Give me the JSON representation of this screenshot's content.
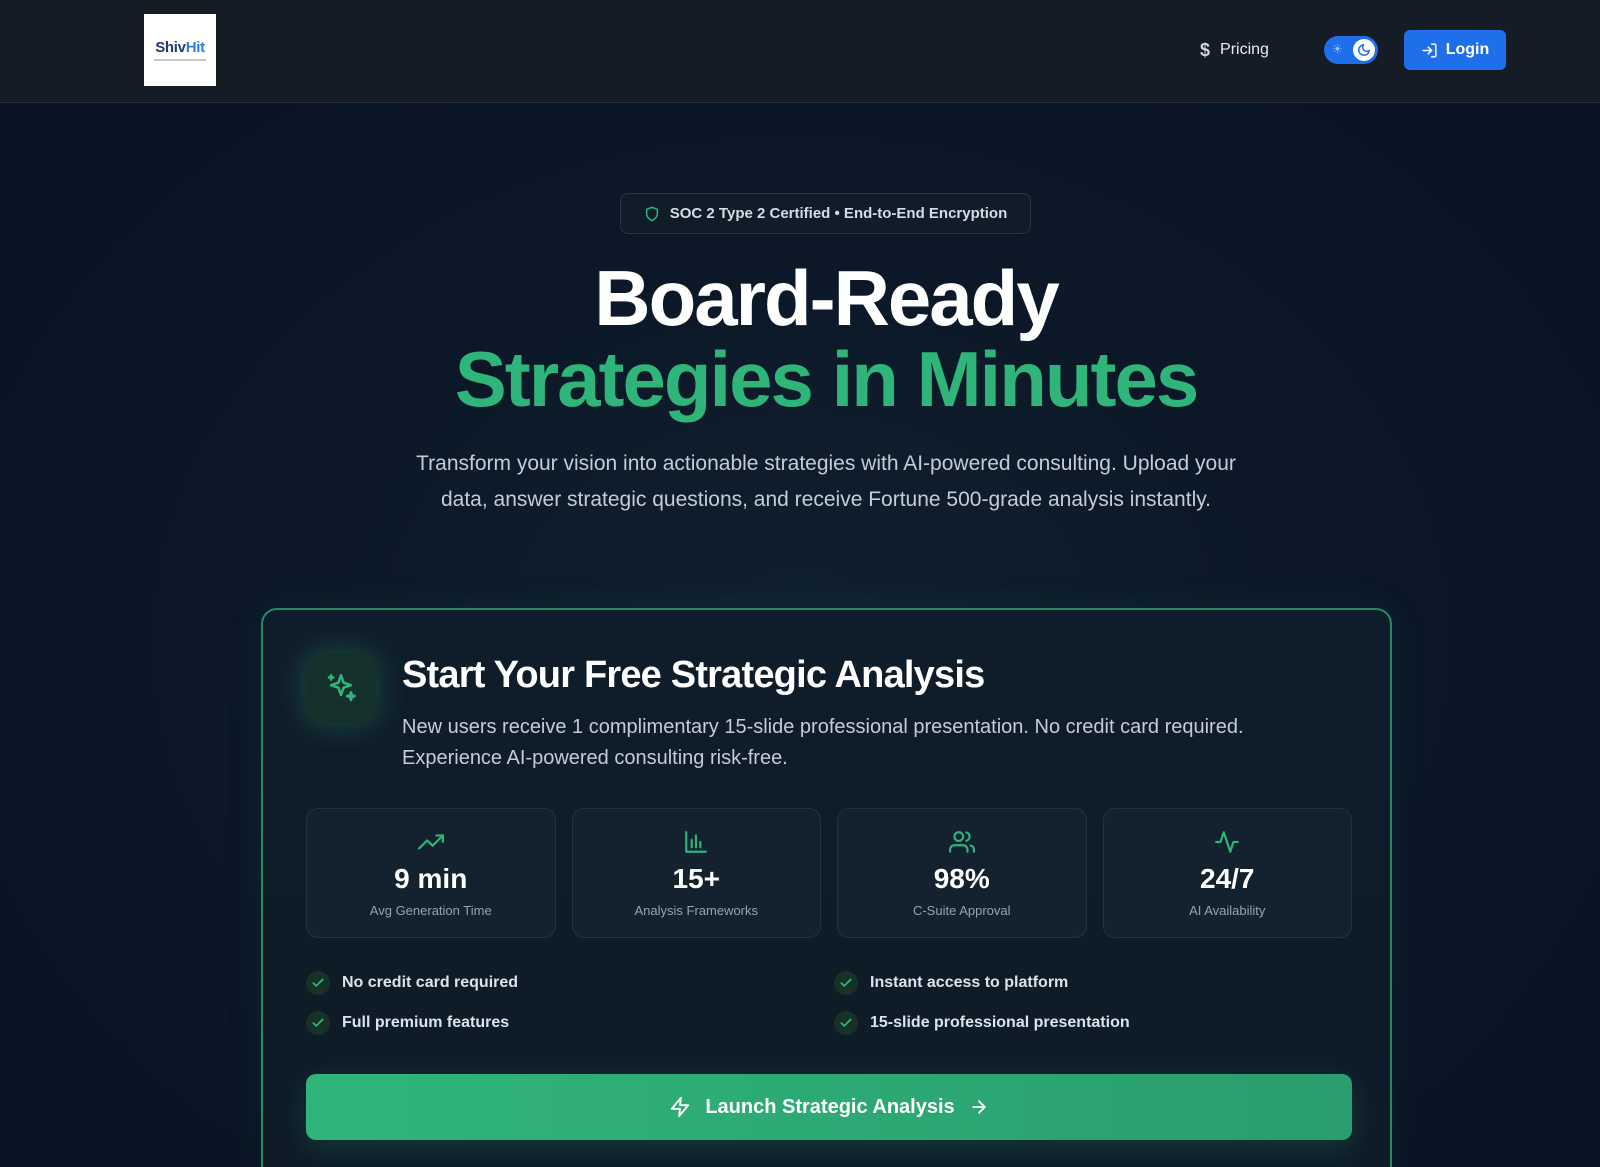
{
  "header": {
    "logo": {
      "word_a": "Shiv",
      "word_b": "Hit"
    },
    "pricing_label": "Pricing",
    "login_label": "Login",
    "theme_toggle": {
      "state": "dark"
    }
  },
  "hero": {
    "badge": "SOC 2 Type 2 Certified • End-to-End Encryption",
    "title_line1": "Board-Ready",
    "title_line2": "Strategies in Minutes",
    "subtitle": "Transform your vision into actionable strategies with AI-powered consulting. Upload your data, answer strategic questions, and receive Fortune 500-grade analysis instantly."
  },
  "card": {
    "title": "Start Your Free Strategic Analysis",
    "description": "New users receive 1 complimentary 15-slide professional presentation. No credit card required. Experience AI-powered consulting risk-free.",
    "stats": [
      {
        "icon": "trending-up-icon",
        "value": "9 min",
        "label": "Avg Generation Time"
      },
      {
        "icon": "bar-chart-icon",
        "value": "15+",
        "label": "Analysis Frameworks"
      },
      {
        "icon": "users-icon",
        "value": "98%",
        "label": "C-Suite Approval"
      },
      {
        "icon": "activity-icon",
        "value": "24/7",
        "label": "AI Availability"
      }
    ],
    "features": [
      "No credit card required",
      "Instant access to platform",
      "Full premium features",
      "15-slide professional presentation"
    ],
    "cta_label": "Launch Strategic Analysis"
  },
  "colors": {
    "accent_green": "#2fb57a",
    "primary_blue": "#1f6feb",
    "background": "#0b1526"
  }
}
